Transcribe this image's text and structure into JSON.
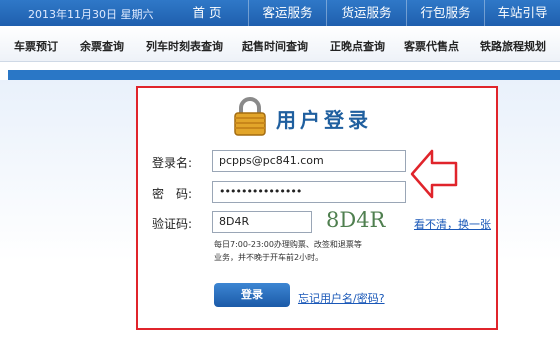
{
  "topbar": {
    "date": "2013年11月30日 星期六",
    "nav": [
      "首 页",
      "客运服务",
      "货运服务",
      "行包服务",
      "车站引导"
    ]
  },
  "secondary_nav": [
    "车票预订",
    "余票查询",
    "列车时刻表查询",
    "起售时间查询",
    "正晚点查询",
    "客票代售点",
    "铁路旅程规划"
  ],
  "login": {
    "title": "用户登录",
    "username_label": "登录名:",
    "username_value": "pcpps@pc841.com",
    "password_label": "密　码:",
    "password_value": "•••••••••••••••",
    "captcha_label": "验证码:",
    "captcha_value": "8D4R",
    "captcha_image_text": "8D4R",
    "refresh_captcha": "看不清，换一张",
    "hint": "每日7:00-23:00办理购票、改签和退票等业务，并不晚于开车前2小时。",
    "login_button": "登录",
    "forgot_link": "忘记用户名/密码?"
  },
  "colors": {
    "brand_blue": "#1f5fae",
    "highlight_red": "#e0242b",
    "title_blue": "#1f5f9f"
  },
  "icons": {
    "lock": "padlock-icon",
    "arrow": "left-arrow-annotation"
  }
}
